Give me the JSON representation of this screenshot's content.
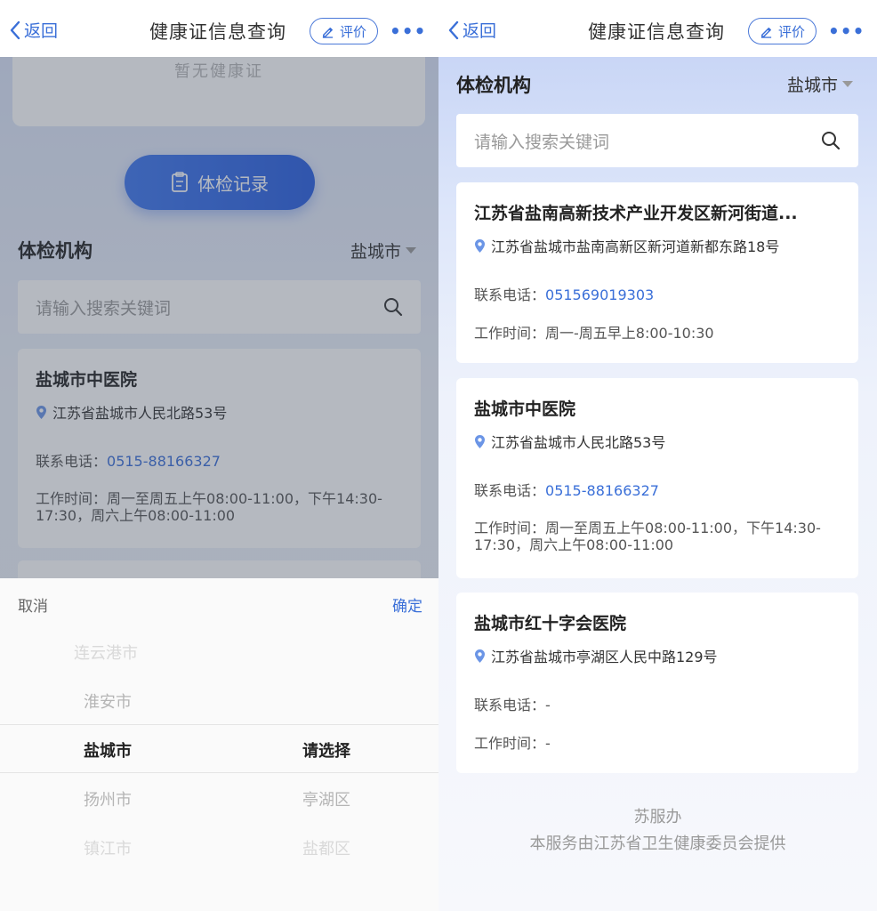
{
  "nav": {
    "back_label": "返回",
    "title": "健康证信息查询",
    "rate_label": "评价",
    "more_label": "•••"
  },
  "left": {
    "cert_empty_text": "暂无健康证",
    "exam_record_label": "体检记录",
    "section_title": "体检机构",
    "city": "盐城市",
    "search_placeholder": "请输入搜索关键词",
    "card": {
      "name": "盐城市中医院",
      "address": "江苏省盐城市人民北路53号",
      "phone_label": "联系电话：",
      "phone": "0515-88166327",
      "hours_label": "工作时间：",
      "hours": "周一至周五上午08:00-11:00，下午14:30-17:30，周六上午08:00-11:00"
    },
    "picker": {
      "cancel_label": "取消",
      "confirm_label": "确定",
      "col1": [
        "连云港市",
        "淮安市",
        "盐城市",
        "扬州市",
        "镇江市"
      ],
      "col2": [
        "请选择",
        "亭湖区",
        "盐都区"
      ]
    }
  },
  "right": {
    "section_title": "体检机构",
    "city": "盐城市",
    "search_placeholder": "请输入搜索关键词",
    "cards": [
      {
        "name": "江苏省盐南高新技术产业开发区新河街道...",
        "address": "江苏省盐城市盐南高新区新河道新都东路18号",
        "phone_label": "联系电话：",
        "phone": "051569019303",
        "hours_label": "工作时间：",
        "hours": "周一-周五早上8:00-10:30"
      },
      {
        "name": "盐城市中医院",
        "address": "江苏省盐城市人民北路53号",
        "phone_label": "联系电话：",
        "phone": "0515-88166327",
        "hours_label": "工作时间：",
        "hours": "周一至周五上午08:00-11:00，下午14:30-17:30，周六上午08:00-11:00"
      },
      {
        "name": "盐城市红十字会医院",
        "address": "江苏省盐城市亭湖区人民中路129号",
        "phone_label": "联系电话：",
        "phone": "-",
        "hours_label": "工作时间：",
        "hours": "-"
      }
    ],
    "footer_brand": "苏服办",
    "footer_note": "本服务由江苏省卫生健康委员会提供"
  },
  "colors": {
    "accent": "#3a6fd8",
    "button": "#2f66e6"
  }
}
